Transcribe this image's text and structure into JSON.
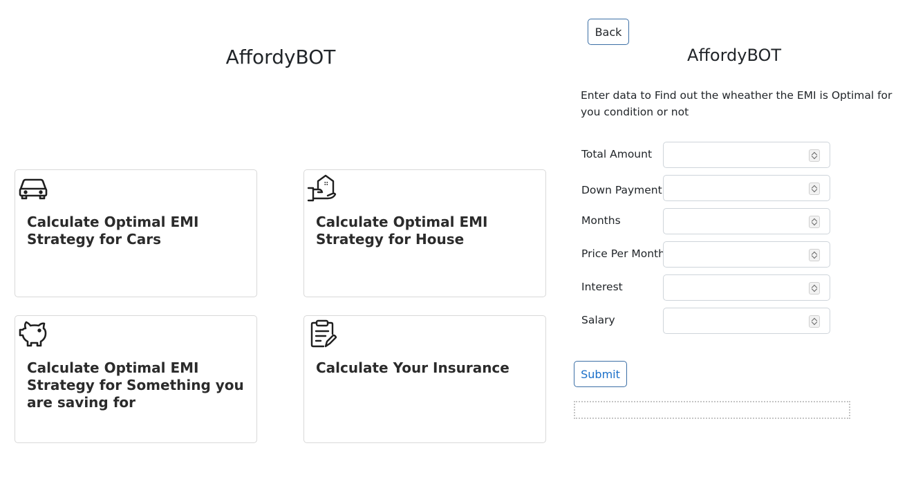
{
  "left": {
    "title": "AffordyBOT",
    "cards": [
      {
        "title": "Calculate Optimal EMI Strategy for Cars",
        "icon": "car-icon"
      },
      {
        "title": "Calculate Optimal EMI Strategy for House",
        "icon": "house-in-hand-icon"
      },
      {
        "title": "Calculate Optimal EMI Strategy for Something you are saving for",
        "icon": "piggy-bank-icon"
      },
      {
        "title": "Calculate Your Insurance",
        "icon": "clipboard-edit-icon"
      }
    ]
  },
  "right": {
    "back_label": "Back",
    "title": "AffordyBOT",
    "intro": "Enter data to Find out the wheather the EMI is Optimal for you condition or not",
    "fields": [
      {
        "label": "Total Amount",
        "value": ""
      },
      {
        "label": "Down Payment",
        "value": ""
      },
      {
        "label": "Months",
        "value": ""
      },
      {
        "label": "Price Per Month",
        "value": ""
      },
      {
        "label": "Interest",
        "value": ""
      },
      {
        "label": "Salary",
        "value": ""
      }
    ],
    "submit_label": "Submit",
    "result": ""
  },
  "colors": {
    "button_border": "#3a6ea5",
    "submit_text": "#1a6fc9",
    "card_border": "#d8d8d8"
  }
}
